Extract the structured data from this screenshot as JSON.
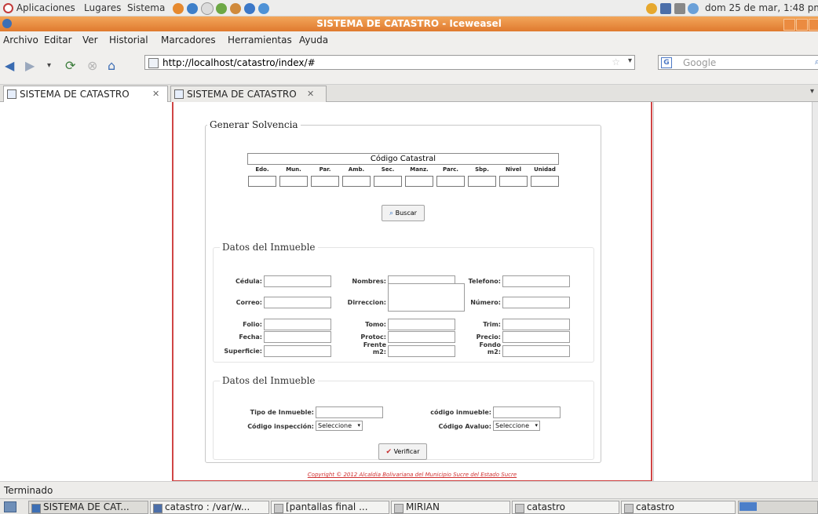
{
  "panel": {
    "menus": [
      "Aplicaciones",
      "Lugares",
      "Sistema"
    ],
    "datetime": "dom 25 de mar,  1:48 pm"
  },
  "window": {
    "title": "SISTEMA DE CATASTRO - Iceweasel"
  },
  "menubar": [
    "Archivo",
    "Editar",
    "Ver",
    "Historial",
    "Marcadores",
    "Herramientas",
    "Ayuda"
  ],
  "nav": {
    "url": "http://localhost/catastro/index/#",
    "search_placeholder": "Google"
  },
  "tabs": [
    {
      "label": "SISTEMA DE CATASTRO"
    },
    {
      "label": "SISTEMA DE CATASTRO"
    }
  ],
  "form": {
    "legend": "Generar Solvencia",
    "catastral_title": "Código Catastral",
    "columns": [
      "Edo.",
      "Mun.",
      "Par.",
      "Amb.",
      "Sec.",
      "Manz.",
      "Parc.",
      "Sbp.",
      "Nivel",
      "Unidad"
    ],
    "buscar_label": "Buscar",
    "datos1": {
      "legend": "Datos del Inmueble",
      "labels": {
        "cedula": "Cédula:",
        "nombres": "Nombres:",
        "telefono": "Telefono:",
        "correo": "Correo:",
        "direccion": "Dirreccion:",
        "numero": "Número:",
        "folio": "Folio:",
        "tomo": "Tomo:",
        "trim": "Trim:",
        "fecha": "Fecha:",
        "protoc": "Protoc:",
        "precio": "Precio:",
        "superficie": "Superficie:",
        "frente_m2": "Frente m2:",
        "fondo_m2": "Fondo m2:"
      }
    },
    "datos2": {
      "legend": "Datos del Inmueble",
      "labels": {
        "tipo_inmueble": "Tipo de Inmueble:",
        "codigo_inmueble": "código inmueble:",
        "codigo_inspeccion": "Código inspección:",
        "codigo_avaluo": "Código Avaluo:"
      },
      "select_inspeccion": "Seleccione",
      "select_avaluo": "Seleccione"
    },
    "verificar_label": "Verificar",
    "copyright": "Copyright © 2012 Alcaldia Bolivariana del Municipio Sucre del Estado Sucre"
  },
  "status": "Terminado",
  "taskbar": [
    "SISTEMA DE CAT...",
    "catastro : /var/w...",
    "[pantallas final ...",
    "MIRIAN",
    "catastro",
    "catastro"
  ],
  "colors": {
    "titlebar": "#e07a2f",
    "page_border": "#d04545",
    "copyright": "#d03030"
  }
}
